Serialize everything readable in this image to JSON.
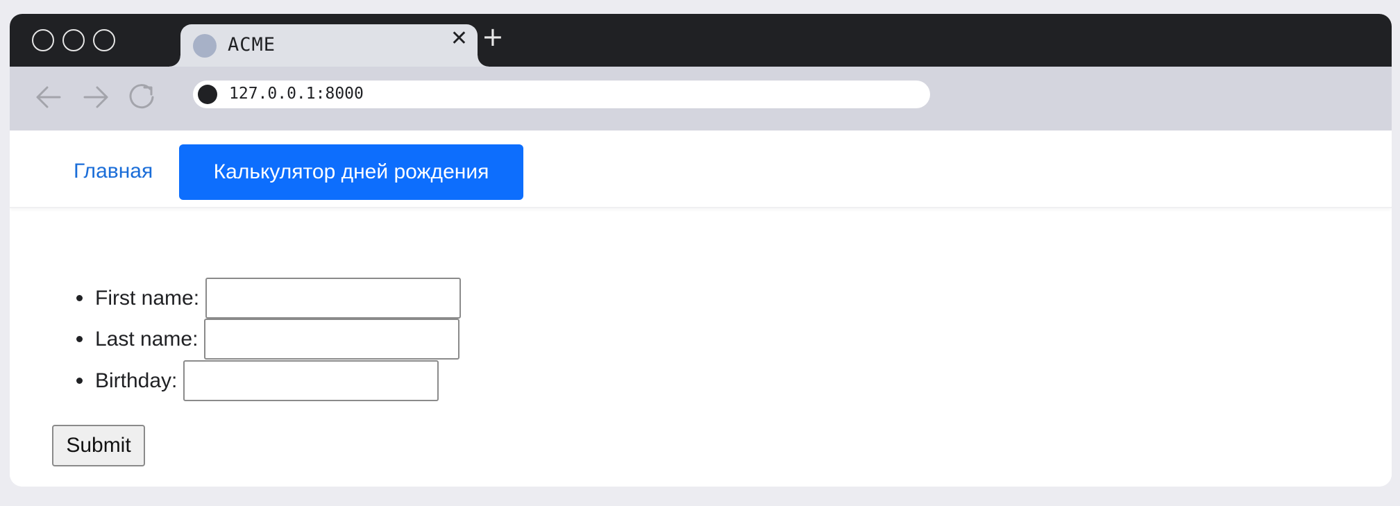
{
  "browser": {
    "tab_title": "ACME",
    "tab_close_glyph": "✕",
    "new_tab_glyph": "+",
    "url": "127.0.0.1:8000",
    "icons": [
      "back-arrow-icon",
      "forward-arrow-icon",
      "reload-icon",
      "site-info-icon"
    ]
  },
  "navbar": {
    "home_label": "Главная",
    "active_label": "Калькулятор дней рождения",
    "accent_color": "#0d6efd",
    "link_color": "#1a6dd8"
  },
  "form": {
    "fields": [
      {
        "label": "First name:",
        "value": ""
      },
      {
        "label": "Last name:",
        "value": ""
      },
      {
        "label": "Birthday:",
        "value": ""
      }
    ],
    "submit_label": "Submit"
  }
}
